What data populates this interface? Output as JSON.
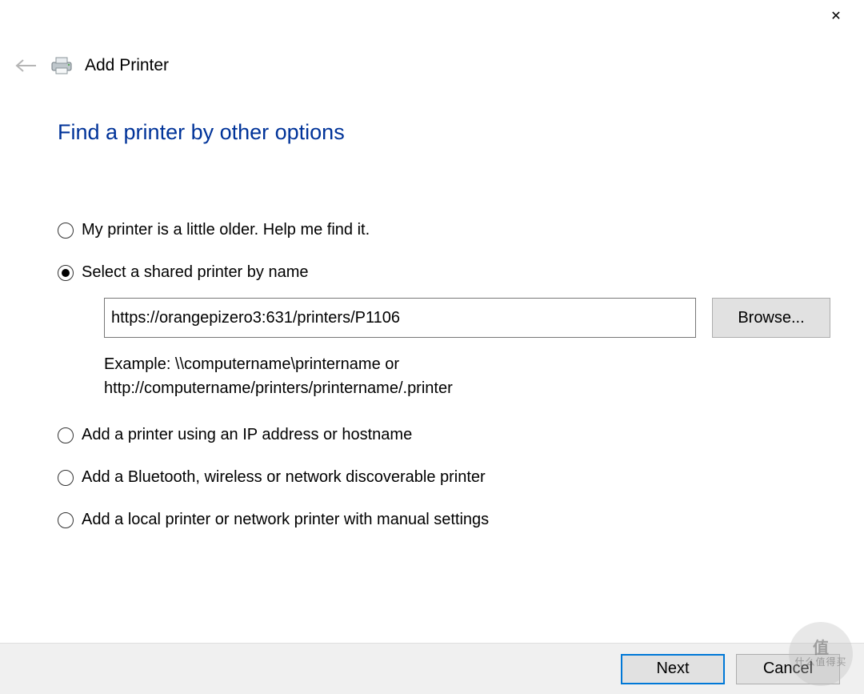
{
  "window": {
    "close_symbol": "✕"
  },
  "header": {
    "title": "Add Printer"
  },
  "page": {
    "heading": "Find a printer by other options"
  },
  "options": {
    "older": "My printer is a little older. Help me find it.",
    "shared": "Select a shared printer by name",
    "ip": "Add a printer using an IP address or hostname",
    "bluetooth": "Add a Bluetooth, wireless or network discoverable printer",
    "local": "Add a local printer or network printer with manual settings",
    "selected": "shared"
  },
  "shared_section": {
    "url_value": "https://orangepizero3:631/printers/P1106",
    "browse_label": "Browse...",
    "example_line1": "Example: \\\\computername\\printername or",
    "example_line2": "http://computername/printers/printername/.printer"
  },
  "footer": {
    "next": "Next",
    "cancel": "Cancel"
  },
  "watermark": {
    "line1": "值",
    "line2": "什么值得买"
  }
}
